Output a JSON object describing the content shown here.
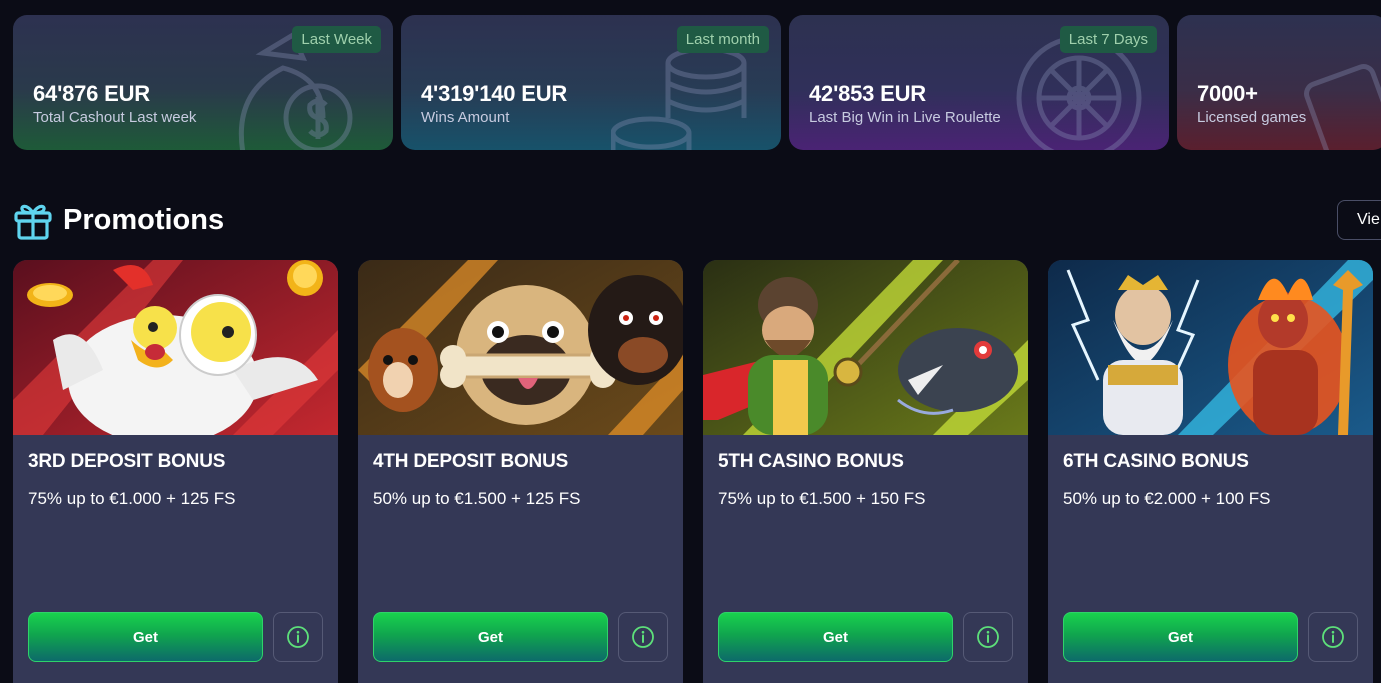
{
  "stats": [
    {
      "tag": "Last Week",
      "value": "64'876 EUR",
      "label": "Total Cashout Last week",
      "icon": "money-bag-icon"
    },
    {
      "tag": "Last month",
      "value": "4'319'140 EUR",
      "label": "Wins Amount",
      "icon": "coin-stack-icon"
    },
    {
      "tag": "Last 7 Days",
      "value": "42'853 EUR",
      "label": "Last Big Win in Live Roulette",
      "icon": "roulette-wheel-icon"
    },
    {
      "tag": "",
      "value": "7000+",
      "label": "Licensed games",
      "icon": "cards-icon"
    }
  ],
  "promotions": {
    "title": "Promotions",
    "icon": "gift-icon",
    "view_all_label": "Vie"
  },
  "cards": [
    {
      "title": "3RD DEPOSIT BONUS",
      "desc": "75% up to €1.000 + 125 FS",
      "get_label": "Get",
      "image": "chicken-with-coins-artwork"
    },
    {
      "title": "4TH DEPOSIT BONUS",
      "desc": "50% up to €1.500 + 125 FS",
      "get_label": "Get",
      "image": "dogs-with-bone-artwork"
    },
    {
      "title": "5TH CASINO BONUS",
      "desc": "75% up to €1.500 + 150 FS",
      "get_label": "Get",
      "image": "fisherman-and-piranha-artwork"
    },
    {
      "title": "6TH CASINO BONUS",
      "desc": "50% up to €2.000 + 100 FS",
      "get_label": "Get",
      "image": "zeus-vs-hades-artwork"
    }
  ],
  "colors": {
    "page_bg": "#0b0c16",
    "card_bg": "#343856",
    "accent_green": "#19d24d",
    "tag_bg": "#1f5a44",
    "info_icon": "#5de07a"
  }
}
